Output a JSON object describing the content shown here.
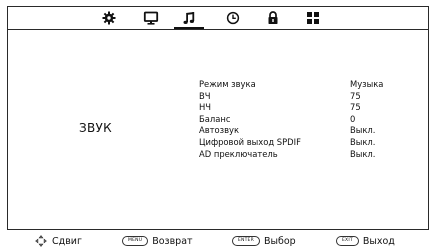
{
  "tabs": [
    {
      "icon": "gear-icon"
    },
    {
      "icon": "monitor-icon"
    },
    {
      "icon": "music-note-icon"
    },
    {
      "icon": "clock-icon"
    },
    {
      "icon": "lock-icon"
    },
    {
      "icon": "grid-icon"
    }
  ],
  "active_tab": "music-note-icon",
  "section_title": "ЗВУК",
  "settings": [
    {
      "label": "Режим звука",
      "value": "Музыка"
    },
    {
      "label": "ВЧ",
      "value": "75"
    },
    {
      "label": "НЧ",
      "value": "75"
    },
    {
      "label": "Баланс",
      "value": "0"
    },
    {
      "label": "Автозвук",
      "value": "Выкл."
    },
    {
      "label": "Цифровой выход SPDIF",
      "value": "Выкл."
    },
    {
      "label": "AD преключатель",
      "value": "Выкл."
    }
  ],
  "footer": {
    "move": {
      "label": "Сдвиг"
    },
    "menu": {
      "key": "MENU",
      "label": "Возврат"
    },
    "enter": {
      "key": "ENTER",
      "label": "Выбор"
    },
    "exit": {
      "key": "EXIT",
      "label": "Выход"
    }
  }
}
